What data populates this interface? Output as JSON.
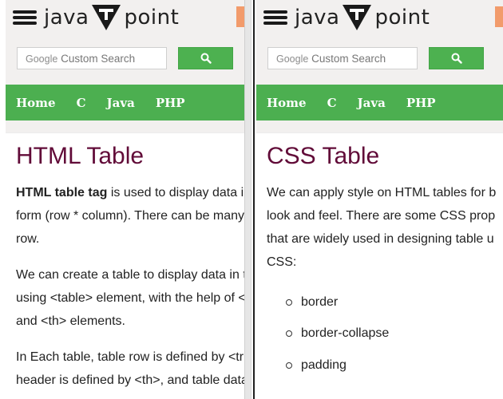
{
  "left_pane": {
    "logo": {
      "left": "java",
      "right": "point"
    },
    "search": {
      "brand": "Google",
      "placeholder": "Custom Search"
    },
    "nav": [
      "Home",
      "C",
      "Java",
      "PHP"
    ],
    "title": "HTML Table",
    "paragraphs": [
      {
        "bold": "HTML table tag",
        "lines": [
          " is used to display data i",
          "form (row * column). There can be many",
          "row."
        ]
      },
      {
        "lines": [
          "We can create a table to display data in t",
          "using <table> element, with the help of <",
          "and <th> elements."
        ]
      },
      {
        "lines": [
          "In Each table, table row is defined by <tr",
          "header is defined by <th>, and table data"
        ]
      }
    ]
  },
  "right_pane": {
    "logo": {
      "left": "java",
      "right": "point"
    },
    "search": {
      "brand": "Google",
      "placeholder": "Custom Search"
    },
    "nav": [
      "Home",
      "C",
      "Java",
      "PHP"
    ],
    "title": "CSS Table",
    "paragraph_lines": [
      "We can apply style on HTML tables for b",
      "look and feel. There are some CSS prop",
      "that are widely used in designing table u",
      "CSS:"
    ],
    "list": [
      "border",
      "border-collapse",
      "padding"
    ]
  },
  "colors": {
    "title": "#610b38",
    "nav_bg": "#4caf50",
    "search_button": "#4db150",
    "accent": "#f29b6b",
    "bg": "#f2f0ef"
  },
  "icons": {
    "menu": "hamburger-icon",
    "search": "search-icon",
    "logo_mark": "t-logo-icon",
    "bullet": "circle-bullet-icon"
  }
}
